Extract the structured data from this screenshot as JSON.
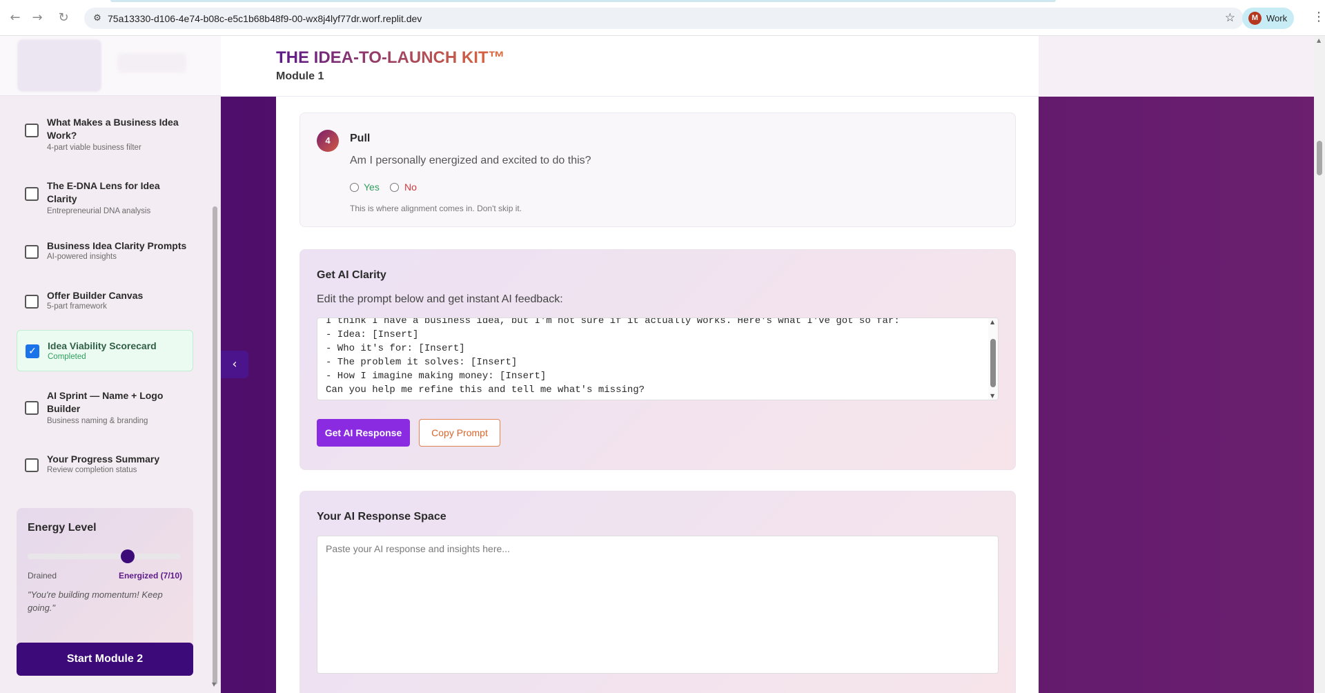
{
  "browser": {
    "url": "75a13330-d106-4e74-b08c-e5c1b68b48f9-00-wx8j4lyf77dr.worf.replit.dev",
    "profile_initial": "M",
    "profile_label": "Work"
  },
  "header": {
    "brand": "THE IDEA-TO-LAUNCH KIT™",
    "module": "Module 1"
  },
  "sidebar": {
    "lessons": [
      {
        "title": "What Makes a Business Idea Work?",
        "subtitle": "4-part viable business filter",
        "checked": false
      },
      {
        "title": "The E-DNA Lens for Idea Clarity",
        "subtitle": "Entrepreneurial DNA analysis",
        "checked": false
      },
      {
        "title": "Business Idea Clarity Prompts",
        "subtitle": "AI-powered insights",
        "checked": false
      },
      {
        "title": "Offer Builder Canvas",
        "subtitle": "5-part framework",
        "checked": false
      },
      {
        "title": "Idea Viability Scorecard",
        "subtitle": "Completed",
        "checked": true
      },
      {
        "title": "AI Sprint — Name + Logo Builder",
        "subtitle": "Business naming & branding",
        "checked": false
      },
      {
        "title": "Your Progress Summary",
        "subtitle": "Review completion status",
        "checked": false
      }
    ],
    "energy": {
      "title": "Energy Level",
      "low_label": "Drained",
      "high_label": "Energized (7/10)",
      "value": 7,
      "max": 10,
      "quote": "\"You're building momentum! Keep going.\""
    },
    "next_button": "Start Module 2"
  },
  "question": {
    "number": "4",
    "title": "Pull",
    "text": "Am I personally energized and excited to do this?",
    "yes_label": "Yes",
    "no_label": "No",
    "hint": "This is where alignment comes in. Don't skip it."
  },
  "ai_clarity": {
    "title": "Get AI Clarity",
    "subtitle": "Edit the prompt below and get instant AI feedback:",
    "prompt_lines": [
      "I think I have a business idea, but I'm not sure if it actually works. Here's what I've got so far:",
      "- Idea: [Insert]",
      "- Who it's for: [Insert]",
      "- The problem it solves: [Insert]",
      "- How I imagine making money: [Insert]",
      "Can you help me refine this and tell me what's missing?"
    ],
    "primary_button": "Get AI Response",
    "secondary_button": "Copy Prompt"
  },
  "response": {
    "title": "Your AI Response Space",
    "placeholder": "Paste your AI response and insights here..."
  },
  "colors": {
    "brand_purple": "#3d0a7a",
    "accent_violet": "#8a2be2",
    "accent_orange": "#d9652c",
    "yes_green": "#2f9e5e",
    "no_red": "#d6363b"
  }
}
